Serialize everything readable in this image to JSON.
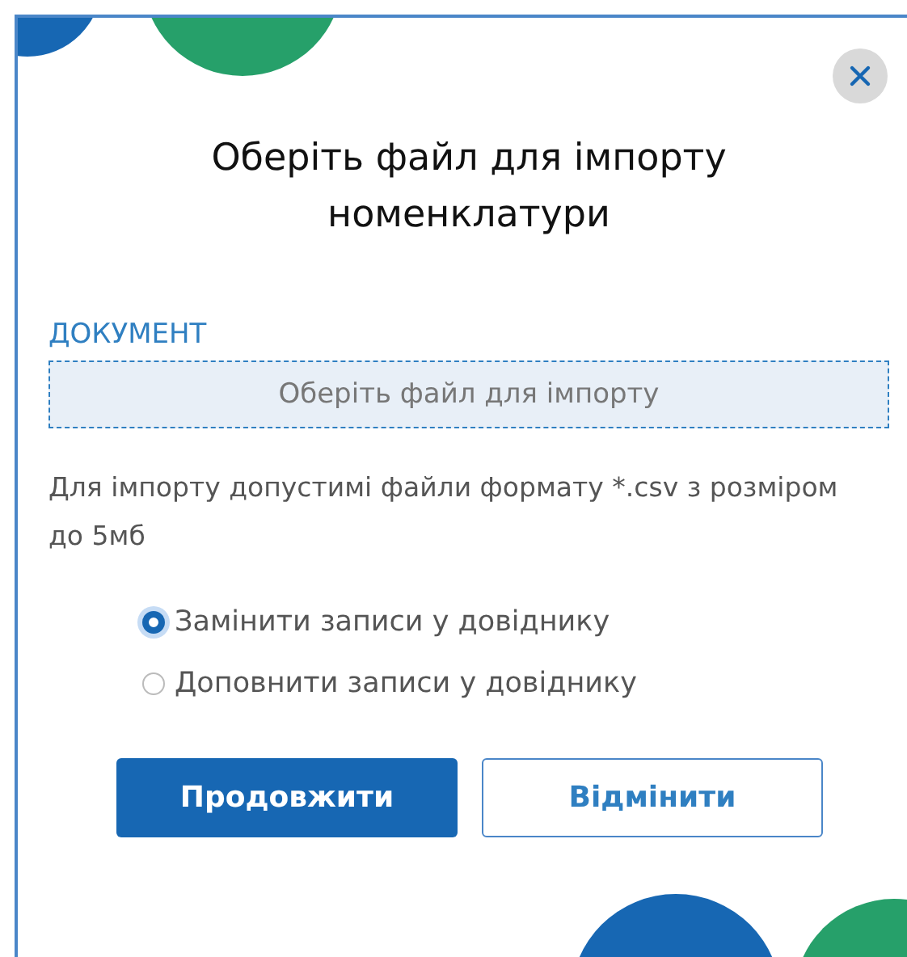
{
  "dialog": {
    "title": "Оберіть файл для імпорту номенклатури"
  },
  "document": {
    "label": "ДОКУМЕНТ",
    "dropzone": "Оберіть файл для імпорту",
    "hint": "Для імпорту допустимі файли формату *.csv з розміром до 5мб"
  },
  "options": [
    {
      "label": "Замінити записи у довіднику",
      "selected": true
    },
    {
      "label": "Доповнити записи у довіднику",
      "selected": false
    }
  ],
  "buttons": [
    {
      "label": "Продовжити",
      "kind": "primary"
    },
    {
      "label": "Відмінити",
      "kind": "secondary"
    }
  ]
}
